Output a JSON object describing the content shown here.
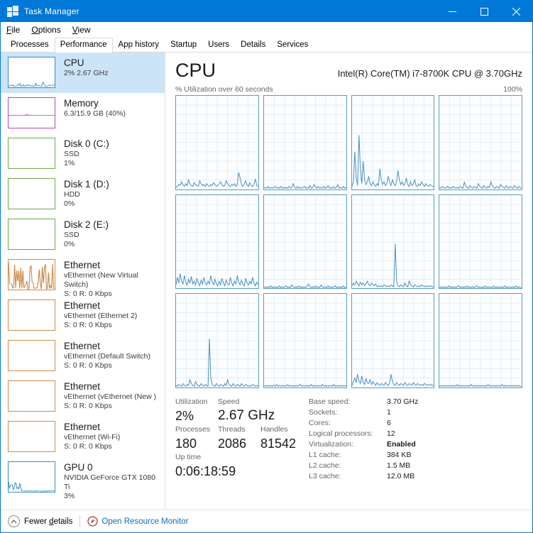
{
  "window": {
    "title": "Task Manager",
    "icon": "task-manager-icon",
    "minimize": "─",
    "maximize": "□",
    "close": "✕"
  },
  "menu": [
    {
      "label": "File",
      "accel": "F"
    },
    {
      "label": "Options",
      "accel": "O"
    },
    {
      "label": "View",
      "accel": "V"
    }
  ],
  "tabs": [
    {
      "label": "Processes",
      "active": false
    },
    {
      "label": "Performance",
      "active": true
    },
    {
      "label": "App history",
      "active": false
    },
    {
      "label": "Startup",
      "active": false
    },
    {
      "label": "Users",
      "active": false
    },
    {
      "label": "Details",
      "active": false
    },
    {
      "label": "Services",
      "active": false
    }
  ],
  "sidebar": {
    "items": [
      {
        "title": "CPU",
        "line2": "2%  2.67 GHz",
        "line3": "",
        "selected": true,
        "color": "#3a8dc4",
        "graph": "cpu"
      },
      {
        "title": "Memory",
        "line2": "6.3/15.9 GB (40%)",
        "line3": "",
        "selected": false,
        "color": "#b44cb4",
        "graph": "memory"
      },
      {
        "title": "Disk 0 (C:)",
        "line2": "SSD",
        "line3": "1%",
        "selected": false,
        "color": "#6bab4a",
        "graph": "flat"
      },
      {
        "title": "Disk 1 (D:)",
        "line2": "HDD",
        "line3": "0%",
        "selected": false,
        "color": "#6bab4a",
        "graph": "flat"
      },
      {
        "title": "Disk 2 (E:)",
        "line2": "SSD",
        "line3": "0%",
        "selected": false,
        "color": "#6bab4a",
        "graph": "flat"
      },
      {
        "title": "Ethernet",
        "line2": "vEthernet (New Virtual Switch)",
        "line3": "S: 0 R: 0 Kbps",
        "selected": false,
        "color": "#cf8b4a",
        "graph": "net"
      },
      {
        "title": "Ethernet",
        "line2": "vEthernet (Ethernet 2)",
        "line3": "S: 0 R: 0 Kbps",
        "selected": false,
        "color": "#cf8b4a",
        "graph": "flat"
      },
      {
        "title": "Ethernet",
        "line2": "vEthernet (Default Switch)",
        "line3": "S: 0 R: 0 Kbps",
        "selected": false,
        "color": "#cf8b4a",
        "graph": "flat"
      },
      {
        "title": "Ethernet",
        "line2": "vEthernet (vEthernet (New )",
        "line3": "S: 0 R: 0 Kbps",
        "selected": false,
        "color": "#cf8b4a",
        "graph": "flat"
      },
      {
        "title": "Ethernet",
        "line2": "vEthernet (Wi-Fi)",
        "line3": "S: 0 R: 0 Kbps",
        "selected": false,
        "color": "#cf8b4a",
        "graph": "flat"
      },
      {
        "title": "GPU 0",
        "line2": "NVIDIA GeForce GTX 1080 Ti",
        "line3": "3%",
        "selected": false,
        "color": "#3a8dc4",
        "graph": "gpu"
      }
    ]
  },
  "main": {
    "title": "CPU",
    "model": "Intel(R) Core(TM) i7-8700K CPU @ 3.70GHz",
    "graph_caption": "% Utilization over 60 seconds",
    "graph_max": "100%"
  },
  "chart_data": {
    "type": "line",
    "title": "% Utilization over 60 seconds",
    "ylabel": "% Utilization",
    "xlabel": "60 seconds",
    "ylim": [
      0,
      100
    ],
    "grid": true,
    "legend": "none",
    "layout": {
      "rows": 3,
      "cols": 4,
      "panels": 12,
      "note": "one panel per logical processor"
    },
    "series": [
      {
        "name": "CPU 0",
        "values": [
          2,
          3,
          5,
          4,
          8,
          5,
          3,
          6,
          4,
          10,
          6,
          4,
          3,
          7,
          5,
          4,
          3,
          9,
          6,
          4,
          5,
          3,
          6,
          4,
          3,
          5,
          4,
          7,
          5,
          3,
          4,
          6,
          8,
          5,
          3,
          4,
          9,
          6,
          4,
          3,
          5,
          4,
          6,
          3,
          5,
          18,
          12,
          5,
          3,
          6,
          9,
          5,
          3,
          7,
          4,
          3,
          5,
          11,
          4,
          3
        ]
      },
      {
        "name": "CPU 1",
        "values": [
          1,
          2,
          1,
          3,
          1,
          2,
          1,
          2,
          3,
          1,
          2,
          1,
          3,
          1,
          2,
          1,
          2,
          1,
          3,
          1,
          2,
          6,
          2,
          1,
          3,
          1,
          2,
          1,
          2,
          3,
          1,
          2,
          1,
          4,
          1,
          2,
          5,
          2,
          1,
          3,
          1,
          2,
          1,
          3,
          1,
          2,
          4,
          1,
          2,
          1,
          3,
          1,
          2,
          5,
          1,
          2,
          1,
          3,
          1,
          2
        ]
      },
      {
        "name": "CPU 2",
        "values": [
          3,
          8,
          40,
          12,
          4,
          58,
          22,
          6,
          30,
          10,
          5,
          8,
          14,
          6,
          4,
          8,
          5,
          3,
          6,
          4,
          22,
          10,
          5,
          8,
          4,
          6,
          14,
          8,
          4,
          10,
          6,
          4,
          8,
          20,
          10,
          5,
          8,
          4,
          6,
          12,
          5,
          3,
          8,
          4,
          6,
          10,
          4,
          3,
          6,
          4,
          8,
          5,
          3,
          6,
          4,
          3,
          5,
          4,
          3,
          2
        ]
      },
      {
        "name": "CPU 3",
        "values": [
          2,
          1,
          3,
          2,
          1,
          2,
          3,
          1,
          2,
          1,
          3,
          2,
          1,
          2,
          1,
          3,
          2,
          1,
          8,
          3,
          2,
          1,
          4,
          2,
          1,
          3,
          2,
          1,
          6,
          3,
          2,
          1,
          4,
          2,
          1,
          3,
          2,
          8,
          4,
          2,
          1,
          3,
          2,
          1,
          5,
          3,
          2,
          1,
          4,
          2,
          1,
          3,
          2,
          1,
          4,
          2,
          1,
          3,
          2,
          1
        ]
      },
      {
        "name": "CPU 4",
        "values": [
          4,
          12,
          6,
          16,
          8,
          5,
          14,
          7,
          4,
          10,
          6,
          13,
          5,
          8,
          4,
          11,
          6,
          3,
          9,
          5,
          12,
          6,
          4,
          8,
          5,
          14,
          7,
          4,
          10,
          5,
          3,
          8,
          4,
          11,
          6,
          3,
          9,
          5,
          4,
          12,
          6,
          3,
          8,
          5,
          14,
          7,
          4,
          9,
          5,
          3,
          11,
          6,
          4,
          8,
          5,
          12,
          6,
          3,
          7,
          4
        ]
      },
      {
        "name": "CPU 5",
        "values": [
          1,
          2,
          1,
          2,
          1,
          3,
          1,
          2,
          1,
          2,
          1,
          3,
          1,
          2,
          1,
          2,
          3,
          1,
          2,
          1,
          4,
          2,
          1,
          2,
          1,
          3,
          1,
          2,
          1,
          2,
          1,
          3,
          5,
          2,
          1,
          2,
          1,
          3,
          1,
          2,
          1,
          4,
          2,
          1,
          2,
          1,
          3,
          1,
          2,
          1,
          2,
          3,
          1,
          2,
          1,
          2,
          1,
          3,
          1,
          2
        ]
      },
      {
        "name": "CPU 6",
        "values": [
          3,
          6,
          4,
          8,
          5,
          3,
          7,
          4,
          6,
          3,
          5,
          8,
          4,
          3,
          6,
          4,
          3,
          5,
          2,
          3,
          2,
          3,
          2,
          4,
          3,
          2,
          3,
          2,
          4,
          3,
          2,
          48,
          8,
          3,
          2,
          4,
          3,
          2,
          6,
          3,
          2,
          8,
          4,
          3,
          2,
          4,
          3,
          2,
          3,
          2,
          4,
          3,
          2,
          3,
          2,
          3,
          2,
          3,
          2,
          1
        ]
      },
      {
        "name": "CPU 7",
        "values": [
          1,
          2,
          1,
          2,
          1,
          2,
          1,
          3,
          1,
          2,
          1,
          2,
          1,
          2,
          3,
          1,
          2,
          1,
          2,
          1,
          3,
          1,
          2,
          1,
          2,
          1,
          2,
          3,
          1,
          2,
          1,
          2,
          1,
          3,
          1,
          2,
          1,
          2,
          1,
          3,
          1,
          2,
          1,
          2,
          1,
          2,
          1,
          3,
          1,
          2,
          1,
          2,
          1,
          2,
          1,
          3,
          1,
          2,
          1,
          1
        ]
      },
      {
        "name": "CPU 8",
        "values": [
          2,
          1,
          3,
          2,
          1,
          4,
          2,
          1,
          3,
          2,
          8,
          4,
          2,
          1,
          6,
          3,
          2,
          1,
          4,
          2,
          1,
          3,
          2,
          1,
          52,
          10,
          3,
          2,
          1,
          4,
          2,
          1,
          3,
          2,
          1,
          4,
          2,
          8,
          3,
          2,
          1,
          4,
          2,
          1,
          3,
          2,
          1,
          4,
          2,
          1,
          3,
          2,
          1,
          2,
          1,
          3,
          2,
          1,
          2,
          1
        ]
      },
      {
        "name": "CPU 9",
        "values": [
          1,
          2,
          1,
          2,
          1,
          2,
          1,
          2,
          1,
          3,
          1,
          2,
          1,
          2,
          1,
          2,
          1,
          3,
          1,
          2,
          1,
          2,
          1,
          2,
          1,
          2,
          3,
          1,
          2,
          1,
          2,
          1,
          2,
          1,
          3,
          1,
          2,
          1,
          2,
          1,
          2,
          1,
          3,
          1,
          2,
          1,
          2,
          1,
          2,
          1,
          3,
          1,
          2,
          1,
          2,
          1,
          2,
          1,
          2,
          1
        ]
      },
      {
        "name": "CPU 10",
        "values": [
          2,
          6,
          10,
          5,
          14,
          7,
          4,
          12,
          6,
          3,
          9,
          5,
          4,
          8,
          3,
          6,
          4,
          2,
          5,
          3,
          2,
          4,
          3,
          2,
          5,
          3,
          2,
          4,
          14,
          6,
          3,
          2,
          5,
          3,
          2,
          4,
          3,
          2,
          5,
          3,
          2,
          4,
          3,
          2,
          5,
          3,
          2,
          4,
          3,
          2,
          3,
          2,
          4,
          3,
          2,
          3,
          2,
          3,
          2,
          1
        ]
      },
      {
        "name": "CPU 11",
        "values": [
          1,
          2,
          1,
          2,
          1,
          2,
          1,
          2,
          1,
          2,
          1,
          2,
          1,
          3,
          1,
          2,
          1,
          2,
          1,
          2,
          1,
          2,
          1,
          3,
          1,
          2,
          1,
          2,
          1,
          2,
          1,
          2,
          1,
          2,
          1,
          3,
          1,
          2,
          1,
          2,
          1,
          2,
          1,
          2,
          1,
          3,
          1,
          2,
          1,
          2,
          1,
          2,
          1,
          2,
          1,
          2,
          1,
          2,
          1,
          1
        ]
      }
    ]
  },
  "stats": {
    "utilization_label": "Utilization",
    "utilization_value": "2%",
    "speed_label": "Speed",
    "speed_value": "2.67 GHz",
    "processes_label": "Processes",
    "processes_value": "180",
    "threads_label": "Threads",
    "threads_value": "2086",
    "handles_label": "Handles",
    "handles_value": "81542",
    "uptime_label": "Up time",
    "uptime_value": "0:06:18:59"
  },
  "specs": [
    {
      "label": "Base speed:",
      "value": "3.70 GHz",
      "bold": false
    },
    {
      "label": "Sockets:",
      "value": "1",
      "bold": false
    },
    {
      "label": "Cores:",
      "value": "6",
      "bold": false
    },
    {
      "label": "Logical processors:",
      "value": "12",
      "bold": false
    },
    {
      "label": "Virtualization:",
      "value": "Enabled",
      "bold": true
    },
    {
      "label": "L1 cache:",
      "value": "384 KB",
      "bold": false
    },
    {
      "label": "L2 cache:",
      "value": "1.5 MB",
      "bold": false
    },
    {
      "label": "L3 cache:",
      "value": "12.0 MB",
      "bold": false
    }
  ],
  "statusbar": {
    "fewer_details": "Fewer details",
    "fewer_accel": "d",
    "resource_monitor": "Open Resource Monitor"
  },
  "colors": {
    "titlebar": "#0078d7",
    "selection": "#cce4f7",
    "link": "#0f6cbd",
    "cpu_line": "#4a90c4"
  }
}
